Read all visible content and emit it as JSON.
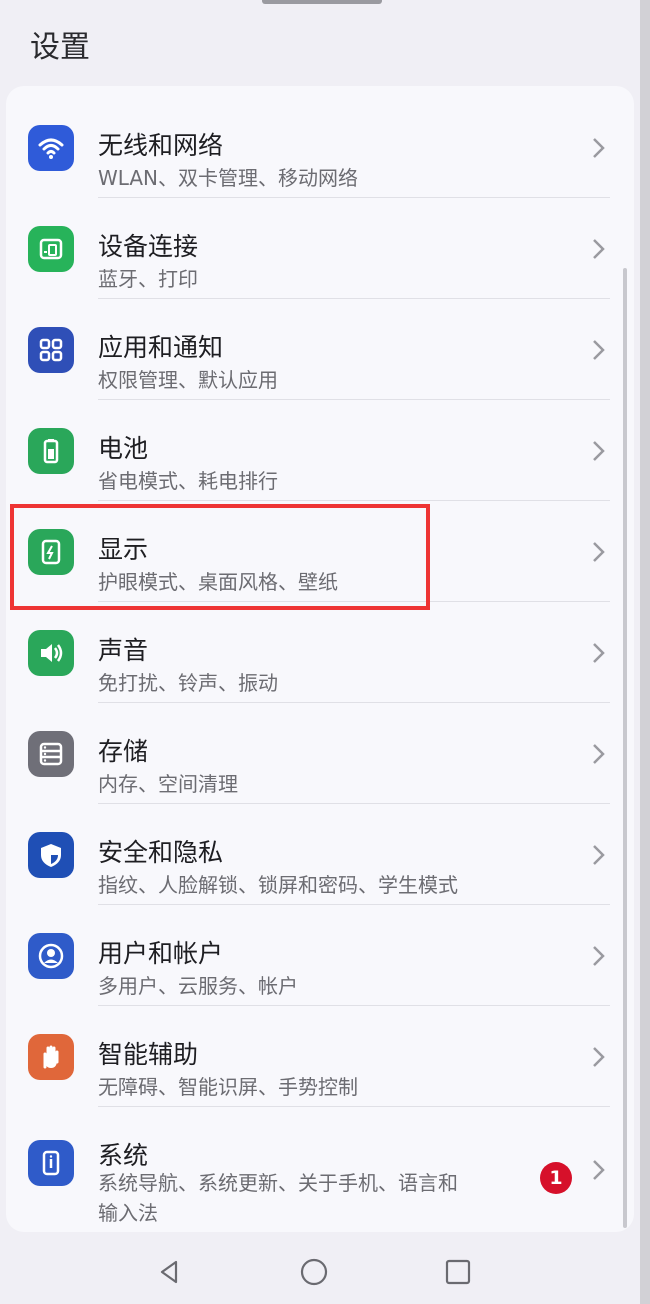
{
  "screen": {
    "title": "设置"
  },
  "items": [
    {
      "label": "无线和网络",
      "sub": "WLAN、双卡管理、移动网络",
      "icon": "wifi-icon",
      "color": "#2f5bd9"
    },
    {
      "label": "设备连接",
      "sub": "蓝牙、打印",
      "icon": "device-connect-icon",
      "color": "#27b35a"
    },
    {
      "label": "应用和通知",
      "sub": "权限管理、默认应用",
      "icon": "apps-grid-icon",
      "color": "#2f4fb7"
    },
    {
      "label": "电池",
      "sub": "省电模式、耗电排行",
      "icon": "battery-icon",
      "color": "#2aa75a"
    },
    {
      "label": "显示",
      "sub": "护眼模式、桌面风格、壁纸",
      "icon": "display-icon",
      "color": "#2aa75a"
    },
    {
      "label": "声音",
      "sub": "免打扰、铃声、振动",
      "icon": "speaker-icon",
      "color": "#2aa75a"
    },
    {
      "label": "存储",
      "sub": "内存、空间清理",
      "icon": "storage-icon",
      "color": "#6f6f78"
    },
    {
      "label": "安全和隐私",
      "sub": "指纹、人脸解锁、锁屏和密码、学生模式",
      "icon": "shield-icon",
      "color": "#1f4fb5"
    },
    {
      "label": "用户和帐户",
      "sub": "多用户、云服务、帐户",
      "icon": "user-icon",
      "color": "#2f5bc9"
    },
    {
      "label": "智能辅助",
      "sub": "无障碍、智能识屏、手势控制",
      "icon": "hand-icon",
      "color": "#e0673a"
    },
    {
      "label": "系统",
      "sub": "系统导航、系统更新、关于手机、语言和输入法",
      "sub_line1": "系统导航、系统更新、关于手机、语言和",
      "sub_line2": "输入法",
      "icon": "phone-info-icon",
      "color": "#2f5bc9",
      "badge": "1"
    }
  ],
  "highlight": {
    "target": "显示",
    "color": "#ee3434"
  },
  "navbar": {
    "back": "back-icon",
    "home": "home-icon",
    "recents": "recents-icon"
  }
}
